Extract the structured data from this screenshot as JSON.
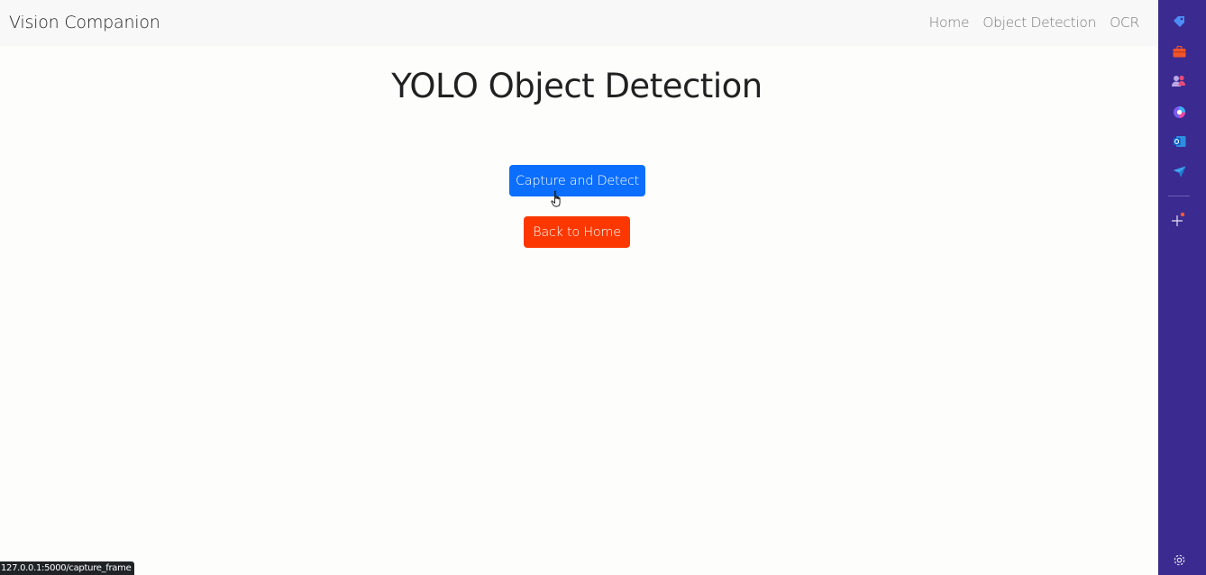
{
  "navbar": {
    "brand": "Vision Companion",
    "links": [
      "Home",
      "Object Detection",
      "OCR"
    ]
  },
  "main": {
    "title": "YOLO Object Detection",
    "capture_button": "Capture and Detect",
    "back_button": "Back to Home"
  },
  "status_bar": {
    "url": "127.0.0.1:5000/capture_frame"
  },
  "sidebar": {
    "icons": [
      "tag-icon",
      "briefcase-icon",
      "people-icon",
      "copilot-icon",
      "outlook-icon",
      "send-icon",
      "add-icon",
      "settings-icon"
    ]
  },
  "colors": {
    "primary": "#0b6efd",
    "danger": "#fc3800",
    "sidebar": "#3b2a8f"
  }
}
